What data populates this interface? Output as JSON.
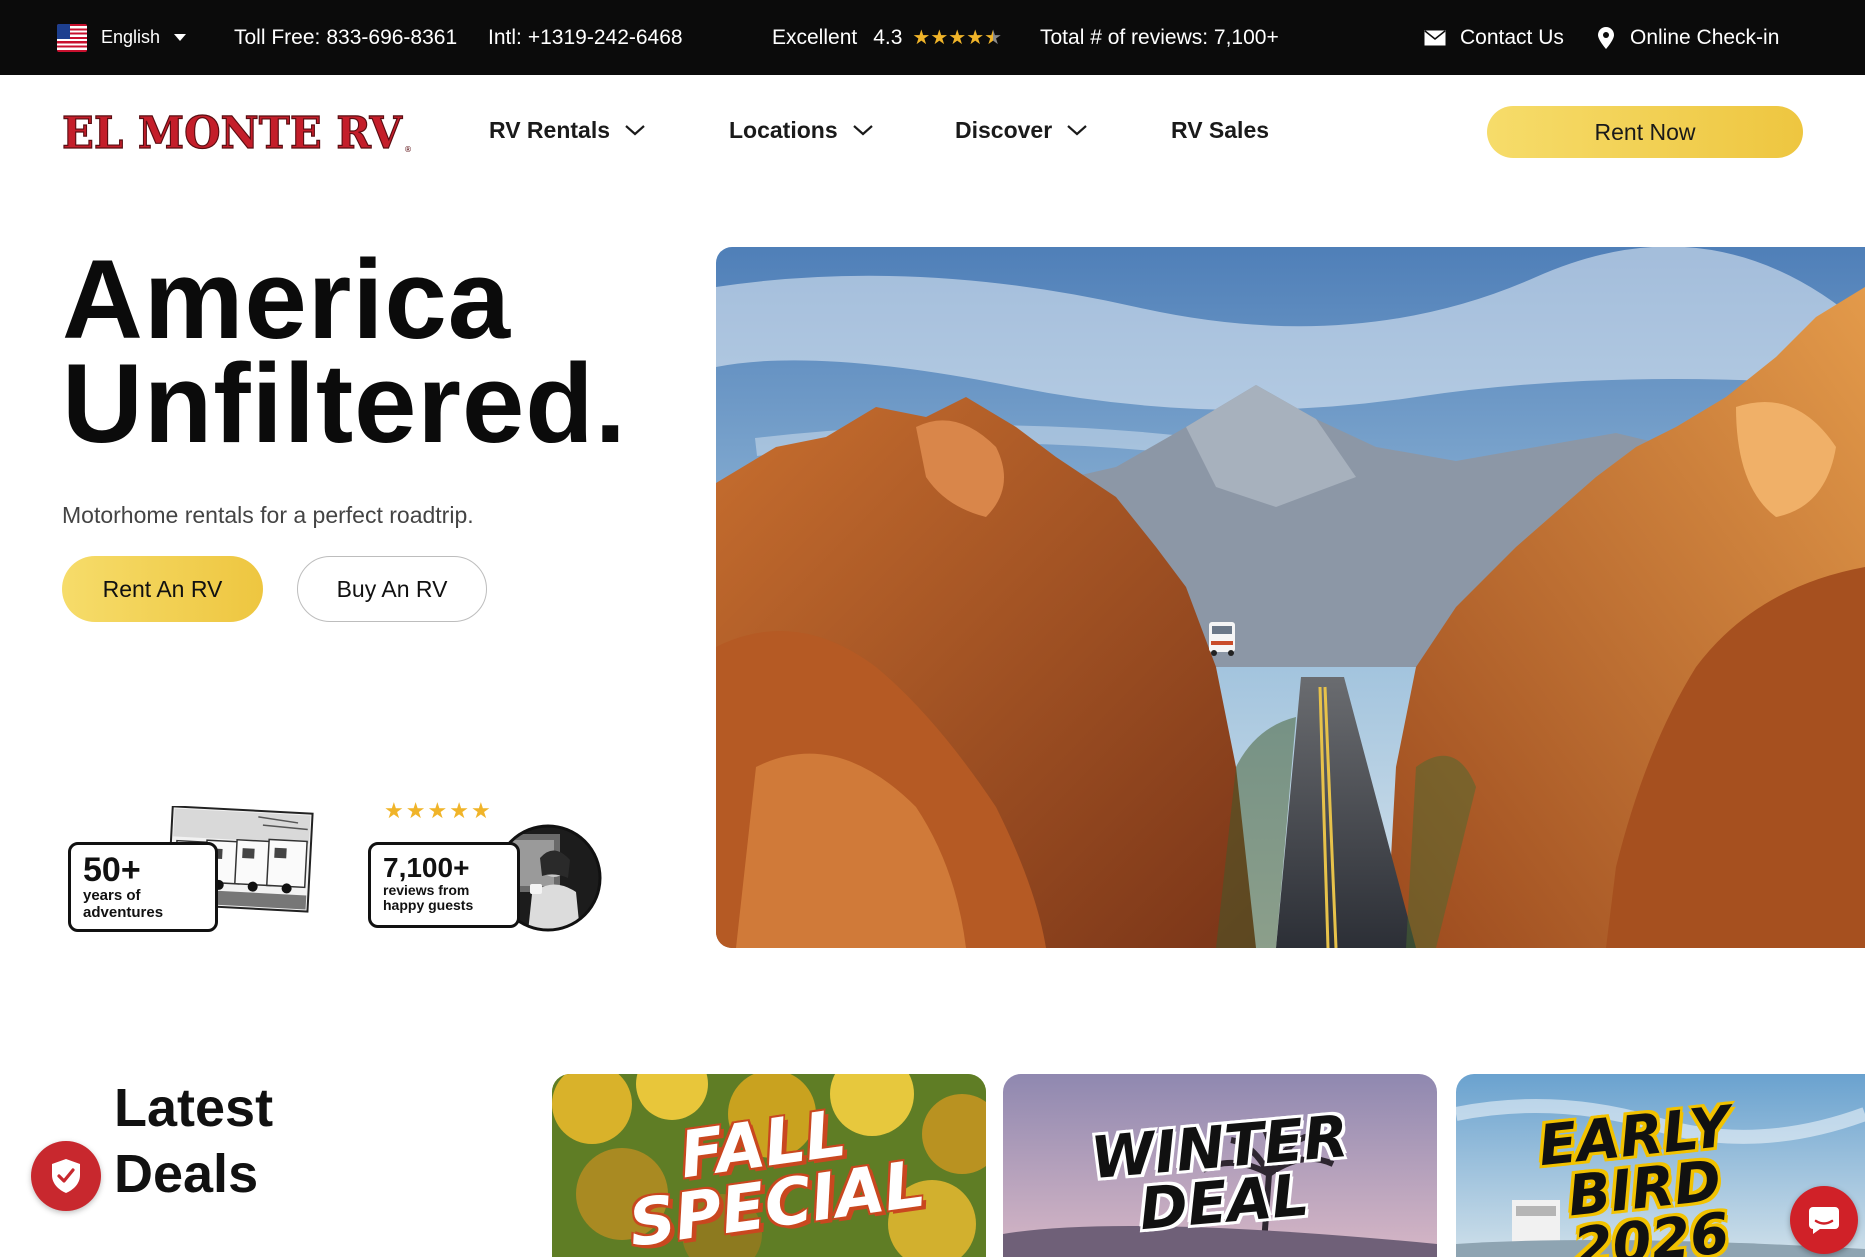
{
  "topbar": {
    "language": "English",
    "toll_free_label": "Toll Free:",
    "toll_free_number": "833-696-8361",
    "intl_label": "Intl:",
    "intl_number": "+1319-242-6468",
    "rating_word": "Excellent",
    "rating_value": "4.3",
    "rating_stars": 4.3,
    "reviews_text": "Total # of reviews: 7,100+",
    "contact": "Contact Us",
    "checkin": "Online Check-in"
  },
  "nav": {
    "logo_text": "EL MONTE RV",
    "items": [
      {
        "label": "RV Rentals",
        "has_dropdown": true
      },
      {
        "label": "Locations",
        "has_dropdown": true
      },
      {
        "label": "Discover",
        "has_dropdown": true
      },
      {
        "label": "RV Sales",
        "has_dropdown": false
      }
    ],
    "cta": "Rent Now"
  },
  "hero": {
    "title_line1": "America",
    "title_line2": "Unfiltered.",
    "subtitle": "Motorhome rentals for a perfect roadtrip.",
    "primary_button": "Rent An RV",
    "secondary_button": "Buy An RV",
    "badge_years": {
      "big": "50+",
      "line1": "years of",
      "line2": "adventures"
    },
    "badge_reviews": {
      "big": "7,100+",
      "line1": "reviews from",
      "line2": "happy guests",
      "stars": 5
    }
  },
  "deals": {
    "title_line1": "Latest",
    "title_line2": "Deals",
    "cards": [
      {
        "line1": "FALL",
        "line2": "SPECIAL"
      },
      {
        "line1": "WINTER",
        "line2": "DEAL"
      },
      {
        "line1": "EARLY",
        "line2": "BIRD",
        "line3": "2026"
      }
    ]
  },
  "colors": {
    "topbar_bg": "#0b0b0b",
    "accent_yellow": "#f2d050",
    "brand_red": "#c8282e",
    "star_gold": "#f0b429"
  }
}
